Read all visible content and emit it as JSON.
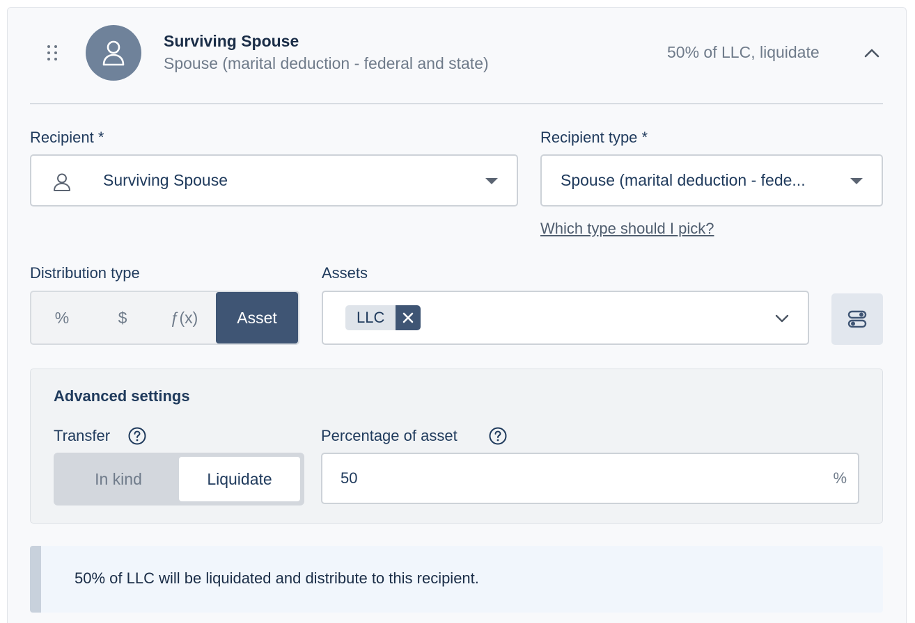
{
  "header": {
    "title": "Surviving Spouse",
    "subtitle": "Spouse (marital deduction - federal and state)",
    "summary": "50% of LLC, liquidate"
  },
  "recipient": {
    "label": "Recipient *",
    "value": "Surviving Spouse"
  },
  "recipient_type": {
    "label": "Recipient type *",
    "value": "Spouse (marital deduction - fede...",
    "help_link": "Which type should I pick?"
  },
  "distribution_type": {
    "label": "Distribution type",
    "options": [
      "%",
      "$",
      "ƒ(x)",
      "Asset"
    ],
    "selected": "Asset"
  },
  "assets": {
    "label": "Assets",
    "selected_chips": [
      "LLC"
    ]
  },
  "advanced": {
    "title": "Advanced settings",
    "transfer": {
      "label": "Transfer",
      "options": [
        "In kind",
        "Liquidate"
      ],
      "selected": "Liquidate"
    },
    "percentage": {
      "label": "Percentage of asset",
      "value": "50",
      "suffix": "%"
    }
  },
  "info": {
    "message": "50% of LLC will be liquidated and distribute to this recipient."
  },
  "colors": {
    "accent": "#3f5574",
    "avatar_bg": "#6f829a",
    "text_primary": "#1f3a5c",
    "text_muted": "#6f7b8a"
  },
  "icons": {
    "drag": "drag-handle-icon",
    "avatar": "user-icon",
    "collapse": "chevron-up-icon",
    "asset_settings": "toggle-settings-icon",
    "help": "help-circle-icon"
  }
}
